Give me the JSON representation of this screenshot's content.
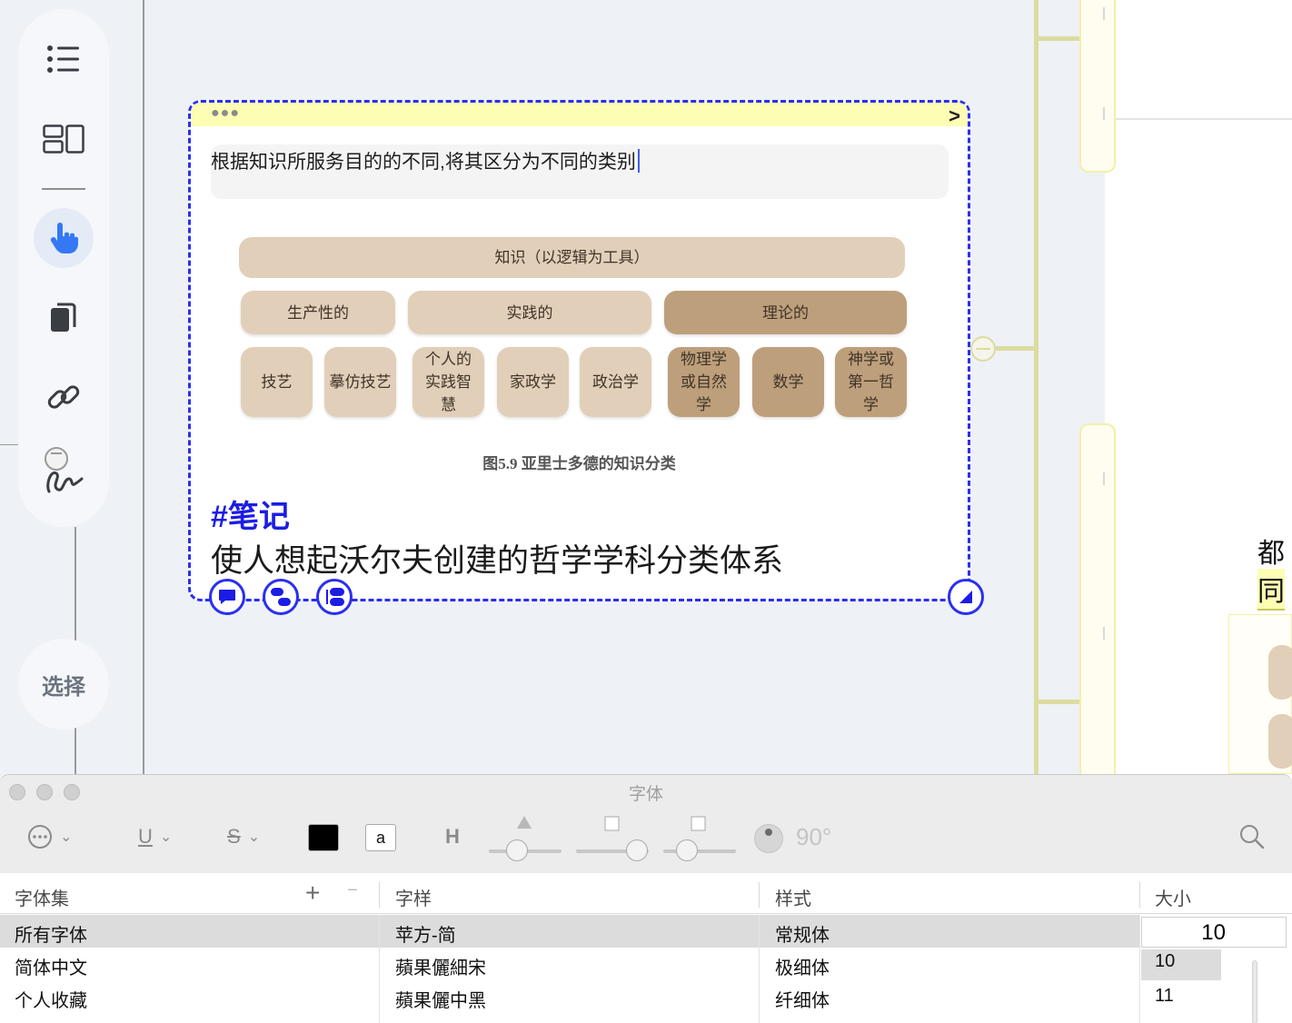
{
  "sidebar": {
    "icons": [
      "list-icon",
      "layout-icon",
      "hand-pointer-icon",
      "copy-icon",
      "link-icon",
      "lasso-icon"
    ],
    "select_label": "选择"
  },
  "card": {
    "title": "根据知识所服务目的的不同,将其区分为不同的类别",
    "diagram": {
      "root": "知识（以逻辑为工具）",
      "level1": [
        "生产性的",
        "实践的",
        "理论的"
      ],
      "level2": [
        "技艺",
        "摹仿技艺",
        "个人的实践智慧",
        "家政学",
        "政治学",
        "物理学或自然学",
        "数学",
        "神学或第一哲学"
      ],
      "caption": "图5.9 亚里士多德的知识分类"
    },
    "tag": "#笔记",
    "note": "使人想起沃尔夫创建的哲学学科分类体系"
  },
  "peek": {
    "line1": "都",
    "line2": "同"
  },
  "font_panel": {
    "title": "字体",
    "color_well": "#000000",
    "text_color_label": "a",
    "rotation": "90°",
    "columns": {
      "collection": "字体集",
      "family": "字样",
      "typeface": "样式",
      "size": "大小"
    },
    "collection_items": [
      "所有字体",
      "简体中文",
      "个人收藏"
    ],
    "family_items": [
      "苹方-简",
      "蘋果儷細宋",
      "蘋果儷中黑"
    ],
    "typeface_items": [
      "常规体",
      "极细体",
      "纤细体"
    ],
    "size_value": "10",
    "size_items": [
      "10",
      "11"
    ]
  }
}
